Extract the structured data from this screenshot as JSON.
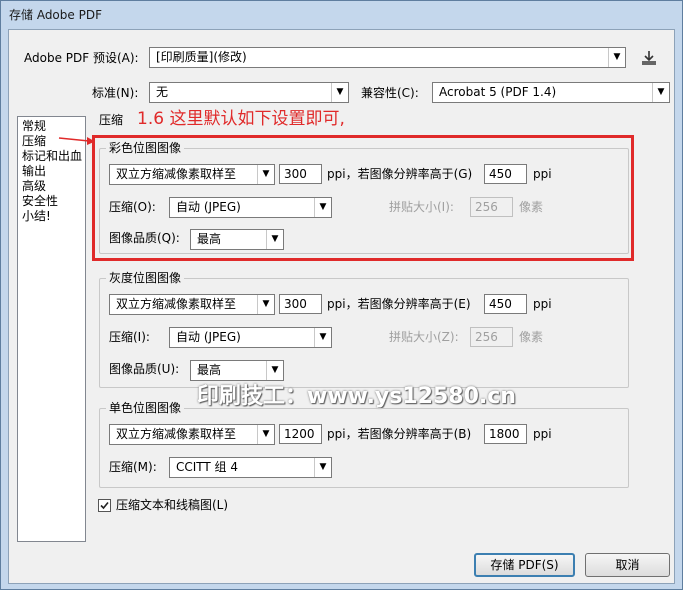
{
  "window": {
    "title": "存储 Adobe PDF"
  },
  "top": {
    "preset_label": "Adobe PDF 预设(A):",
    "preset_value": "[印刷质量](修改)",
    "standard_label": "标准(N):",
    "standard_value": "无",
    "compat_label": "兼容性(C):",
    "compat_value": "Acrobat 5 (PDF 1.4)"
  },
  "sidebar": {
    "items": [
      {
        "label": "常规"
      },
      {
        "label": "压缩"
      },
      {
        "label": "标记和出血"
      },
      {
        "label": "输出"
      },
      {
        "label": "高级"
      },
      {
        "label": "安全性"
      },
      {
        "label": "小结!"
      }
    ]
  },
  "section_title": "压缩",
  "annotation": "1.6 这里默认如下设置即可,",
  "color_group": {
    "title": "彩色位图图像",
    "downsample_value": "双立方缩减像素取样至",
    "ppi_value": "300",
    "ppi_label": "ppi，若图像分辨率高于(G)",
    "threshold_value": "450",
    "ppi_label2": "ppi",
    "compression_label": "压缩(O):",
    "compression_value": "自动 (JPEG)",
    "tile_label": "拼贴大小(I):",
    "tile_value": "256",
    "tile_unit": "像素",
    "quality_label": "图像品质(Q):",
    "quality_value": "最高"
  },
  "gray_group": {
    "title": "灰度位图图像",
    "downsample_value": "双立方缩减像素取样至",
    "ppi_value": "300",
    "ppi_label": "ppi，若图像分辨率高于(E)",
    "threshold_value": "450",
    "ppi_label2": "ppi",
    "compression_label": "压缩(I):",
    "compression_value": "自动 (JPEG)",
    "tile_label": "拼贴大小(Z):",
    "tile_value": "256",
    "tile_unit": "像素",
    "quality_label": "图像品质(U):",
    "quality_value": "最高"
  },
  "mono_group": {
    "title": "单色位图图像",
    "downsample_value": "双立方缩减像素取样至",
    "ppi_value": "1200",
    "ppi_label": "ppi，若图像分辨率高于(B)",
    "threshold_value": "1800",
    "ppi_label2": "ppi",
    "compression_label": "压缩(M):",
    "compression_value": "CCITT 组 4"
  },
  "compress_text": {
    "label": "压缩文本和线稿图(L)",
    "checked": true
  },
  "watermark": "印刷技工：www.ys12580.cn",
  "buttons": {
    "save": "存储 PDF(S)",
    "cancel": "取消"
  },
  "colors": {
    "highlight_border": "#e02a2a",
    "annotation_text": "#e02a2a"
  }
}
